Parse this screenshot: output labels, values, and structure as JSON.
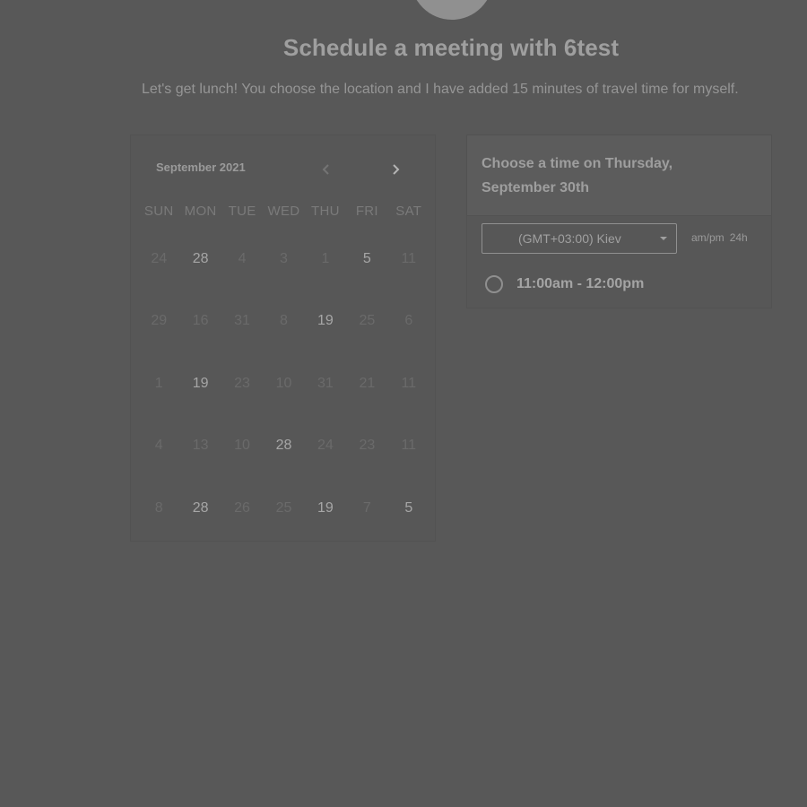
{
  "header": {
    "title": "Schedule a meeting with 6test",
    "description": "Let's get lunch! You choose the location and I have added 15 minutes of travel time for myself."
  },
  "calendar": {
    "month_label": "September 2021",
    "prev_icon": "chevron-left-icon",
    "next_icon": "chevron-right-icon",
    "weekdays": [
      "SUN",
      "MON",
      "TUE",
      "WED",
      "THU",
      "FRI",
      "SAT"
    ],
    "weeks": [
      [
        {
          "d": "24",
          "a": false
        },
        {
          "d": "28",
          "a": true
        },
        {
          "d": "4",
          "a": false
        },
        {
          "d": "3",
          "a": false
        },
        {
          "d": "1",
          "a": false
        },
        {
          "d": "5",
          "a": true
        },
        {
          "d": "11",
          "a": false
        }
      ],
      [
        {
          "d": "29",
          "a": false
        },
        {
          "d": "16",
          "a": false
        },
        {
          "d": "31",
          "a": false
        },
        {
          "d": "8",
          "a": false
        },
        {
          "d": "19",
          "a": true
        },
        {
          "d": "25",
          "a": false
        },
        {
          "d": "6",
          "a": false
        }
      ],
      [
        {
          "d": "1",
          "a": false
        },
        {
          "d": "19",
          "a": true
        },
        {
          "d": "23",
          "a": false
        },
        {
          "d": "10",
          "a": false
        },
        {
          "d": "31",
          "a": false
        },
        {
          "d": "21",
          "a": false
        },
        {
          "d": "11",
          "a": false
        }
      ],
      [
        {
          "d": "4",
          "a": false
        },
        {
          "d": "13",
          "a": false
        },
        {
          "d": "10",
          "a": false
        },
        {
          "d": "28",
          "a": true
        },
        {
          "d": "24",
          "a": false
        },
        {
          "d": "23",
          "a": false
        },
        {
          "d": "11",
          "a": false
        }
      ],
      [
        {
          "d": "8",
          "a": false
        },
        {
          "d": "28",
          "a": true
        },
        {
          "d": "26",
          "a": false
        },
        {
          "d": "25",
          "a": false
        },
        {
          "d": "19",
          "a": true
        },
        {
          "d": "7",
          "a": false
        },
        {
          "d": "5",
          "a": true
        }
      ]
    ]
  },
  "time_panel": {
    "heading": "Choose a time on Thursday, September 30th",
    "timezone": "(GMT+03:00) Kiev",
    "format_ampm": "am/pm",
    "format_24h": "24h",
    "slots": [
      {
        "label": "11:00am - 12:00pm"
      }
    ]
  },
  "colors": {
    "background": "#585858",
    "text_primary": "#a6a6a6",
    "text_muted": "#6a6a6a"
  }
}
